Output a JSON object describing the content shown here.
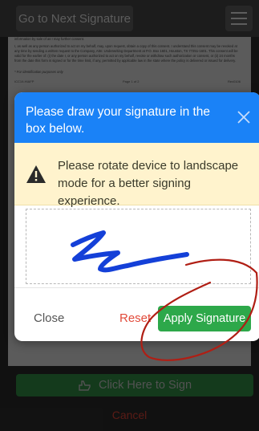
{
  "topbar": {
    "next_signature_label": "Go to Next Signature",
    "menu_icon": "hamburger-menu-icon"
  },
  "document": {
    "paragraphs": [
      "information by sale of as I may further consent.",
      "I, as well as any person authorized to act on my behalf, may, upon request, obtain a copy of this consent. I understand this consent may be revoked at any time by sending a written request to the Company, Attn: Underwriting Department at P.O. Box 1601, Houston, TX 77251-1601. This consent will be valid for the earlier of: (i) the date I, or any person authorized to act on my behalf, revoke or withdraw such authorization or consent, or (ii) 24 months from the date this form is signed or for the time limit, if any, permitted by applicable law in the state where the policy is delivered or issued for delivery.",
      "* For identification purposes only"
    ],
    "footer_left": "ICC19-HIAFP",
    "footer_center": "Page 1 of 2",
    "footer_right": "Rev0106"
  },
  "modal": {
    "title": "Please draw your signature in the box below.",
    "close_icon": "close-icon",
    "warning_icon": "warning-triangle-icon",
    "warning_text": "Please rotate device to landscape mode for a better signing experience.",
    "close_label": "Close",
    "reset_label": "Reset",
    "apply_label": "Apply Signature"
  },
  "bottom": {
    "sign_label": "Click Here to Sign",
    "sign_icon": "pointing-hand-icon",
    "cancel_label": "Cancel"
  },
  "colors": {
    "header_blue": "#1a82f7",
    "warning_bg": "#fff3cd",
    "apply_green": "#2da84a",
    "reset_red": "#e24b3b",
    "signature_ink": "#1440d8",
    "annotation_red": "#b01e14"
  }
}
